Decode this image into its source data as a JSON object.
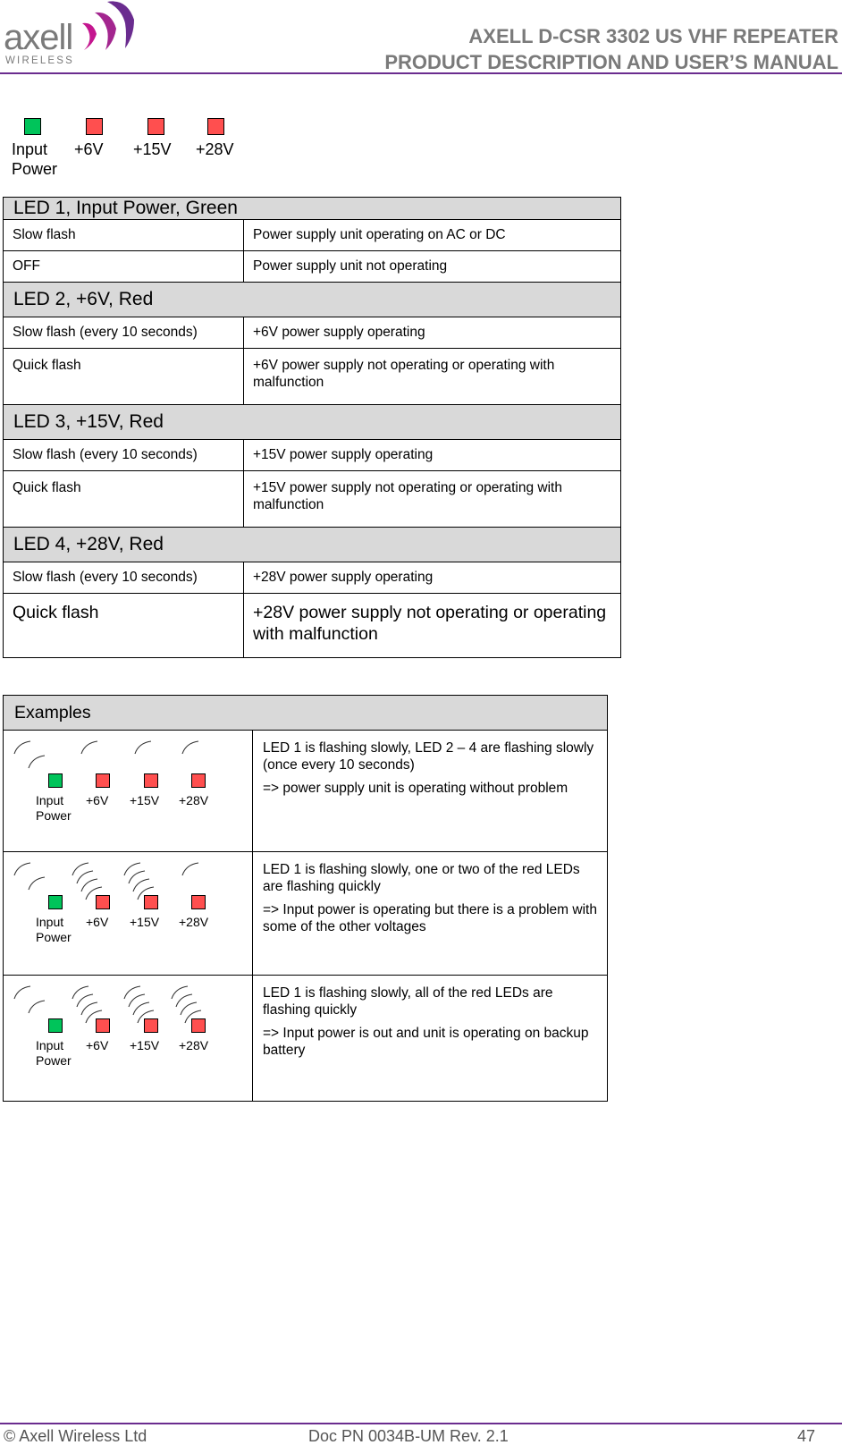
{
  "header": {
    "logo": {
      "brand": "axell",
      "sub": "WIRELESS",
      "colors": {
        "text": "#7a7a7a",
        "mark_magenta": "#c4168f",
        "mark_purple": "#6a2c8f"
      }
    },
    "title_line1": "AXELL D-CSR 3302 US VHF REPEATER",
    "title_line2": "PRODUCT DESCRIPTION AND USER’S MANUAL"
  },
  "legend": {
    "leds": [
      {
        "label_line1": "Input",
        "label_line2": "Power",
        "color": "green"
      },
      {
        "label_line1": "+6V",
        "label_line2": "",
        "color": "red"
      },
      {
        "label_line1": "+15V",
        "label_line2": "",
        "color": "red"
      },
      {
        "label_line1": "+28V",
        "label_line2": "",
        "color": "red"
      }
    ]
  },
  "led_table": {
    "groups": [
      {
        "title": "LED 1, Input Power, Green",
        "rows": [
          {
            "state": "Slow flash",
            "meaning": "Power supply unit operating on AC or DC"
          },
          {
            "state": "OFF",
            "meaning": "Power supply unit not operating"
          }
        ]
      },
      {
        "title": "LED 2, +6V, Red",
        "rows": [
          {
            "state": "Slow flash (every 10 seconds)",
            "meaning": "+6V power supply operating"
          },
          {
            "state": "Quick flash",
            "meaning": "+6V power supply not operating or operating with malfunction"
          }
        ]
      },
      {
        "title": "LED 3, +15V, Red",
        "rows": [
          {
            "state": "Slow flash (every 10 seconds)",
            "meaning": "+15V power supply operating"
          },
          {
            "state": "Quick flash",
            "meaning": "+15V power supply not operating or operating with malfunction"
          }
        ]
      },
      {
        "title": "LED 4, +28V, Red",
        "rows": [
          {
            "state": "Slow flash (every 10 seconds)",
            "meaning": "+28V power supply operating"
          },
          {
            "state": "Quick flash",
            "meaning": "+28V power supply not operating or operating with malfunction"
          }
        ]
      }
    ]
  },
  "examples": {
    "title": "Examples",
    "led_labels": [
      "Input",
      "Power",
      "+6V",
      "+15V",
      "+28V"
    ],
    "items": [
      {
        "flash": [
          "slow",
          "slow",
          "slow",
          "slow"
        ],
        "description": "LED 1 is flashing slowly, LED 2 – 4 are flashing slowly (once every 10 seconds)",
        "result": "=> power supply unit is operating without problem"
      },
      {
        "flash": [
          "slow",
          "quick",
          "quick",
          "slow"
        ],
        "description": "LED 1 is flashing slowly, one or two of  the red LEDs are flashing quickly",
        "result": "=> Input power is operating but there is a problem with some of the other voltages"
      },
      {
        "flash": [
          "slow",
          "quick",
          "quick",
          "quick"
        ],
        "description": "LED 1 is flashing slowly, all of  the red LEDs are flashing quickly",
        "result": "=> Input power is out and unit is operating on backup battery"
      }
    ]
  },
  "colors": {
    "led_green": "#00c45a",
    "led_red": "#ff4f4f",
    "table_header_bg": "#d9d9d9",
    "rule_purple": "#6a2c8f"
  },
  "footer": {
    "copyright": "© Axell Wireless Ltd",
    "doc_pn": "Doc PN 0034B-UM Rev. 2.1",
    "page_number": "47"
  }
}
